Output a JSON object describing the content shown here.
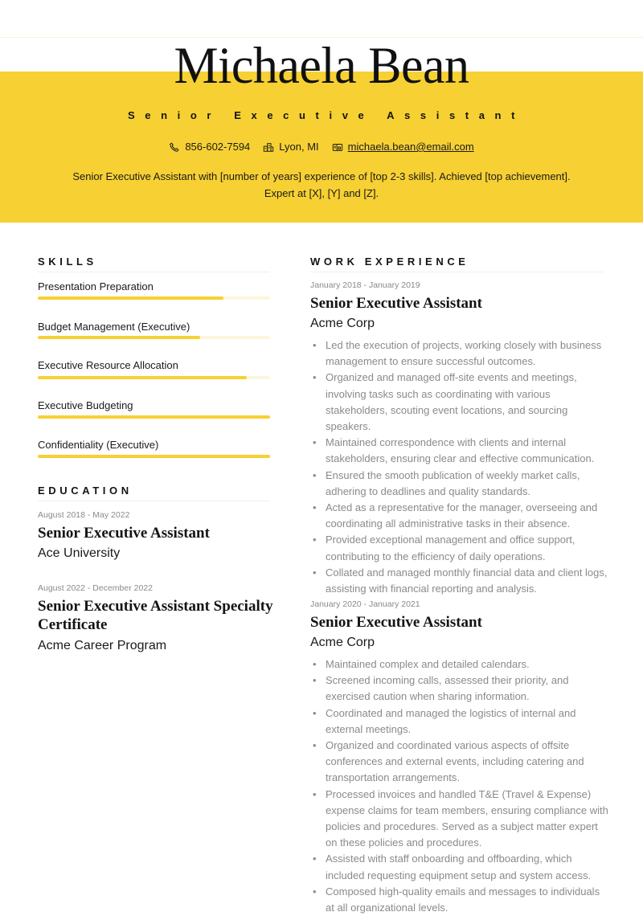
{
  "header": {
    "name": "Michaela Bean",
    "title": "Senior Executive Assistant",
    "contacts": {
      "phone": {
        "icon": "phone-icon",
        "value": "856-602-7594"
      },
      "location": {
        "icon": "location-icon",
        "value": "Lyon, MI"
      },
      "email": {
        "icon": "mail-icon",
        "value": "michaela.bean@email.com"
      }
    },
    "summary": "Senior Executive Assistant with [number of years] experience of [top 2-3 skills]. Achieved [top achievement]. Expert at [X], [Y] and [Z]."
  },
  "colors": {
    "accent": "#f7d033",
    "accent_light": "#fdf6dc",
    "text": "#1a1a1a",
    "muted": "#8a8a8a"
  },
  "skills": {
    "heading": "SKILLS",
    "items": [
      {
        "label": "Presentation Preparation",
        "level": 0.8
      },
      {
        "label": "Budget Management (Executive)",
        "level": 0.7
      },
      {
        "label": "Executive Resource Allocation",
        "level": 0.9
      },
      {
        "label": "Executive Budgeting",
        "level": 1.0
      },
      {
        "label": "Confidentiality (Executive)",
        "level": 1.0
      }
    ]
  },
  "education": {
    "heading": "EDUCATION",
    "items": [
      {
        "dates": "August 2018 - May 2022",
        "degree": "Senior Executive Assistant",
        "school": "Ace University"
      },
      {
        "dates": "August 2022 - December 2022",
        "degree": "Senior Executive Assistant Specialty Certificate",
        "school": "Acme Career Program"
      }
    ]
  },
  "experience": {
    "heading": "WORK EXPERIENCE",
    "items": [
      {
        "dates": "January 2018 - January 2019",
        "title": "Senior Executive Assistant",
        "company": "Acme Corp",
        "bullets": [
          "Led the execution of projects, working closely with business management to ensure successful outcomes.",
          "Organized and managed off-site events and meetings, involving tasks such as coordinating with various stakeholders, scouting event locations, and sourcing speakers.",
          "Maintained correspondence with clients and internal stakeholders, ensuring clear and effective communication.",
          "Ensured the smooth publication of weekly market calls, adhering to deadlines and quality standards.",
          "Acted as a representative for the manager, overseeing and coordinating all administrative tasks in their absence.",
          "Provided exceptional management and office support, contributing to the efficiency of daily operations.",
          "Collated and managed monthly financial data and client logs, assisting with financial reporting and analysis."
        ]
      },
      {
        "dates": "January 2020 - January 2021",
        "title": "Senior Executive Assistant",
        "company": "Acme Corp",
        "bullets": [
          "Maintained complex and detailed calendars.",
          "Screened incoming calls, assessed their priority, and exercised caution when sharing information.",
          "Coordinated and managed the logistics of internal and external meetings.",
          "Organized and coordinated various aspects of offsite conferences and external events, including catering and transportation arrangements.",
          "Processed invoices and handled T&E (Travel & Expense) expense claims for team members, ensuring compliance with policies and procedures. Served as a subject matter expert on these policies and procedures.",
          "Assisted with staff onboarding and offboarding, which included requesting equipment setup and system access.",
          "Composed high-quality emails and messages to individuals at all organizational levels."
        ]
      }
    ]
  }
}
